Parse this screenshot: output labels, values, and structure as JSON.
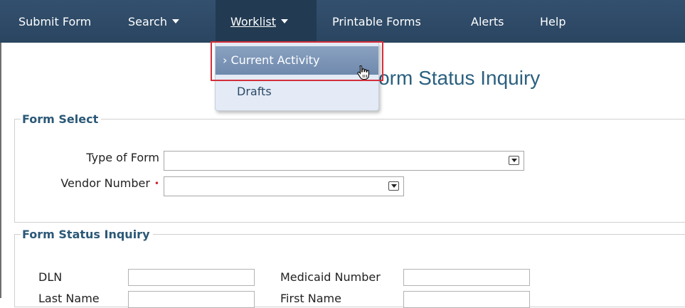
{
  "nav": {
    "submit_form": "Submit Form",
    "search": "Search",
    "worklist": "Worklist",
    "printable_forms": "Printable Forms",
    "alerts": "Alerts",
    "help": "Help"
  },
  "worklist_menu": {
    "current_activity": "Current Activity",
    "current_prefix": "›",
    "drafts": "Drafts"
  },
  "page_title": "Form Status Inquiry",
  "form_select": {
    "legend": "Form Select",
    "type_of_form_label": "Type of Form",
    "type_of_form_value": "",
    "vendor_number_label": "Vendor Number",
    "vendor_number_value": "",
    "required_marker": "•"
  },
  "form_status_inquiry": {
    "legend": "Form Status Inquiry",
    "dln_label": "DLN",
    "medicaid_number_label": "Medicaid Number",
    "last_name_label": "Last Name",
    "first_name_label": "First Name",
    "dln_value": "",
    "medicaid_number_value": "",
    "last_name_value": "",
    "first_name_value": ""
  },
  "colors": {
    "nav_background": "#2e4a68",
    "title": "#2b607f",
    "highlight": "#d42f3b",
    "required": "#d0202a"
  }
}
